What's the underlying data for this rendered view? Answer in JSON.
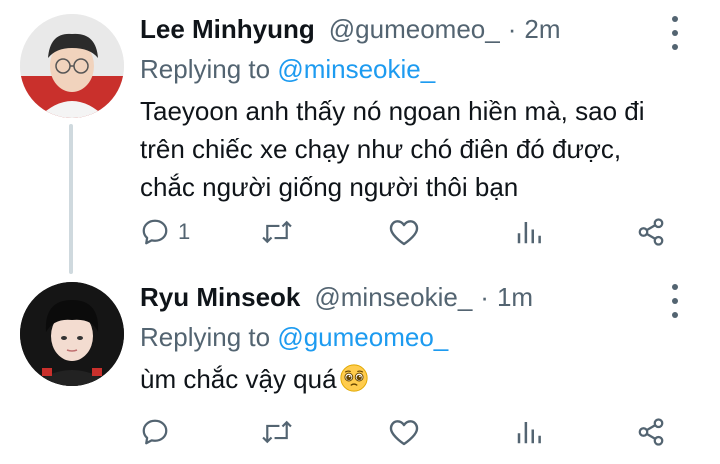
{
  "tweets": [
    {
      "author_name": "Lee Minhyung",
      "handle": "@gumeomeo_",
      "separator": "·",
      "time": "2m",
      "replying_prefix": "Replying to",
      "replying_to": "@minseokie_",
      "text_lines": [
        "Taeyoon anh thấy nó ngoan hiền mà, sao đi",
        "trên chiếc xe chạy như chó điên đó được,",
        "chắc người giống người thôi bạn"
      ],
      "reply_count": "1",
      "retweet_count": "",
      "like_count": "",
      "view_count": ""
    },
    {
      "author_name": "Ryu Minseok",
      "handle": "@minseokie_",
      "separator": "·",
      "time": "1m",
      "replying_prefix": "Replying to",
      "replying_to": "@gumeomeo_",
      "text_lines": [
        "ùm chắc vậy quá"
      ],
      "reply_count": "",
      "retweet_count": "",
      "like_count": "",
      "view_count": ""
    }
  ],
  "icons": {
    "reply": "speech-bubble-icon",
    "retweet": "retweet-arrows-icon",
    "like": "heart-icon",
    "views": "bar-chart-icon",
    "share": "share-icon",
    "more": "vertical-dots-icon",
    "emoji": "pleading-face-emoji"
  },
  "colors": {
    "text": "#0f1419",
    "muted": "#536471",
    "link": "#1d9bf0",
    "thread_line": "#cfd9de"
  }
}
